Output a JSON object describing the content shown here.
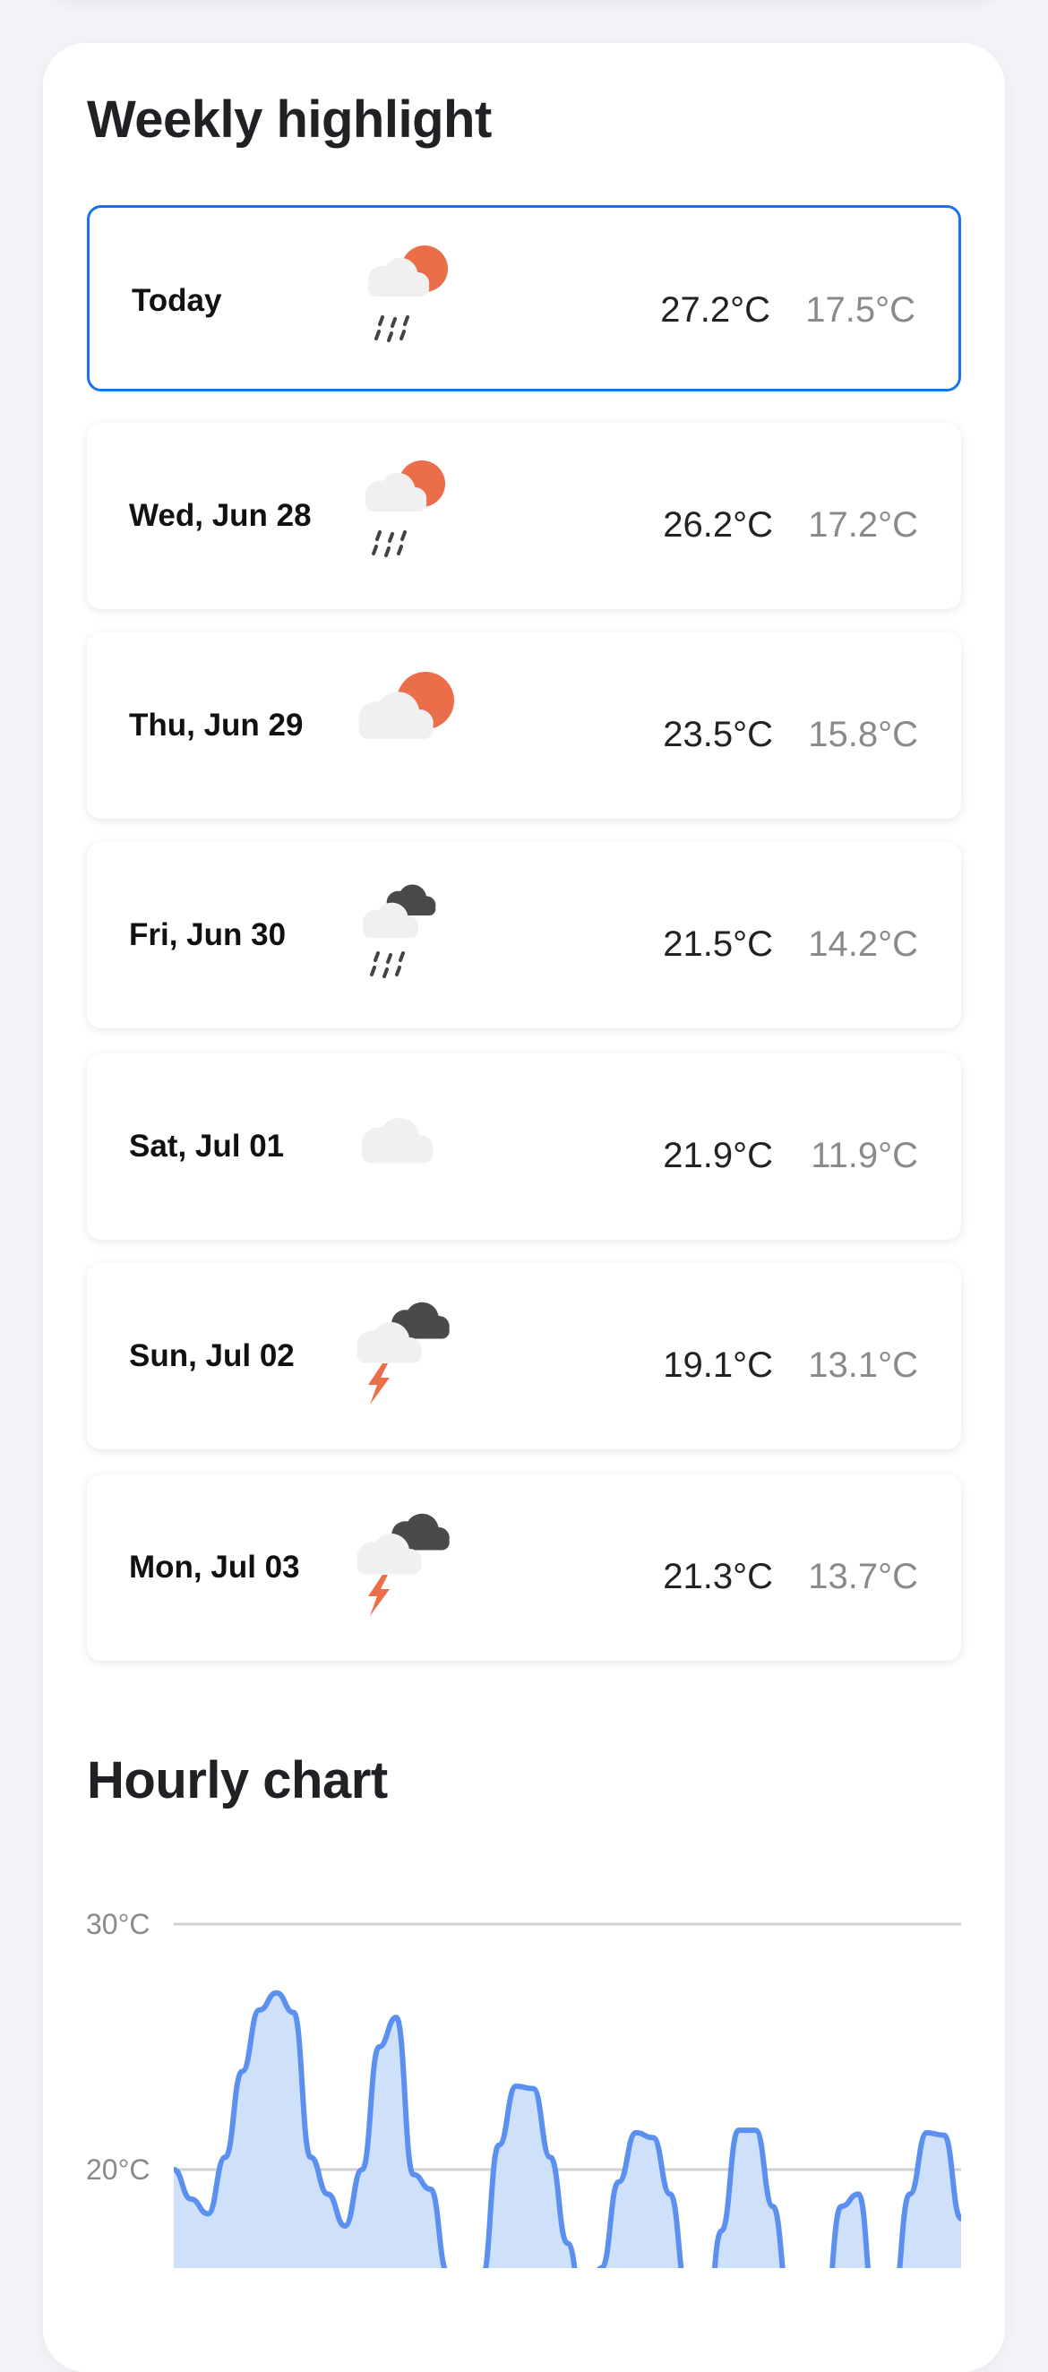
{
  "weekly": {
    "title": "Weekly highlight",
    "days": [
      {
        "label": "Today",
        "high": "27.2°C",
        "low": "17.5°C",
        "icon": "sun-cloud-rain-icon",
        "selected": true
      },
      {
        "label": "Wed, Jun 28",
        "high": "26.2°C",
        "low": "17.2°C",
        "icon": "sun-cloud-rain-icon"
      },
      {
        "label": "Thu, Jun 29",
        "high": "23.5°C",
        "low": "15.8°C",
        "icon": "sun-cloud-icon"
      },
      {
        "label": "Fri, Jun 30",
        "high": "21.5°C",
        "low": "14.2°C",
        "icon": "dark-cloud-rain-icon"
      },
      {
        "label": "Sat, Jul 01",
        "high": "21.9°C",
        "low": "11.9°C",
        "icon": "cloud-icon"
      },
      {
        "label": "Sun, Jul 02",
        "high": "19.1°C",
        "low": "13.1°C",
        "icon": "thunderstorm-icon"
      },
      {
        "label": "Mon, Jul 03",
        "high": "21.3°C",
        "low": "13.7°C",
        "icon": "thunderstorm-icon"
      }
    ]
  },
  "hourly": {
    "title": "Hourly chart"
  },
  "colors": {
    "accent": "#1a73e8",
    "sun": "#eb6e4b",
    "cloud_light": "#f0f0f0",
    "cloud_dark": "#4a4a4a",
    "chart_line": "#5b8ff0",
    "chart_fill": "#cfe0fb"
  },
  "chart_data": {
    "type": "area",
    "title": "Hourly chart",
    "ylabel": "",
    "yticks": [
      "30°C",
      "20°C"
    ],
    "ytick_values": [
      30,
      20
    ],
    "ylim": [
      16,
      32
    ],
    "grid": true,
    "series": [
      {
        "values": [
          20.0,
          18.8,
          18.2,
          20.5,
          24.0,
          26.5,
          27.2,
          26.4,
          20.5,
          19.0,
          17.7,
          20.0,
          25.0,
          26.2,
          19.8,
          19.2,
          15.8,
          13.5,
          15.5,
          21.0,
          23.4,
          23.3,
          20.5,
          17.0,
          14.0,
          16.0,
          19.5,
          21.5,
          21.3,
          19.0,
          15.0,
          12.5,
          17.5,
          21.6,
          21.6,
          18.5,
          14.5,
          12.0,
          14.0,
          18.5,
          19.0,
          14.0,
          14.5,
          19.0,
          21.5,
          21.4,
          18.0
        ]
      }
    ]
  }
}
